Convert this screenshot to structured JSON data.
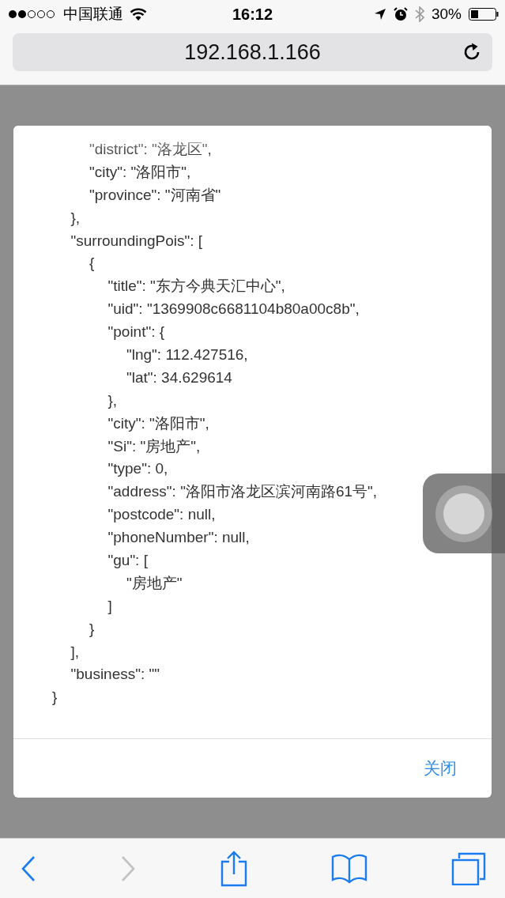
{
  "status_bar": {
    "carrier": "中国联通",
    "time": "16:12",
    "battery": "30%"
  },
  "address_bar": {
    "url": "192.168.1.166"
  },
  "dialog": {
    "lines": [
      {
        "children": [
          {
            "children": [
              {
                "text": "\"district\": \"洛龙区\","
              },
              {
                "text": "\"city\": \"洛阳市\","
              },
              {
                "text": "\"province\": \"河南省\""
              }
            ]
          },
          {
            "text": "},"
          },
          {
            "text": "\"surroundingPois\": [",
            "children": [
              {
                "text": "{",
                "children": [
                  {
                    "text": "\"title\": \"东方今典天汇中心\","
                  },
                  {
                    "text": "\"uid\": \"1369908c6681104b80a00c8b\","
                  },
                  {
                    "text": "\"point\": {",
                    "children": [
                      {
                        "text": "\"lng\": 112.427516,"
                      },
                      {
                        "text": "\"lat\": 34.629614"
                      }
                    ]
                  },
                  {
                    "text": "},"
                  },
                  {
                    "text": "\"city\": \"洛阳市\","
                  },
                  {
                    "text": "\"Si\": \"房地产\","
                  },
                  {
                    "text": "\"type\": 0,"
                  },
                  {
                    "text": "\"address\": \"洛阳市洛龙区滨河南路61号\","
                  },
                  {
                    "text": "\"postcode\": null,"
                  },
                  {
                    "text": "\"phoneNumber\": null,"
                  },
                  {
                    "text": "\"gu\": [",
                    "children": [
                      {
                        "text": "\"房地产\""
                      }
                    ]
                  },
                  {
                    "text": "]"
                  }
                ]
              },
              {
                "text": "}"
              }
            ]
          },
          {
            "text": "],"
          },
          {
            "text": "\"business\": \"\""
          }
        ]
      },
      {
        "text": "}"
      }
    ],
    "close_button": "关闭"
  },
  "toolbar": {
    "back_enabled": true,
    "forward_enabled": false
  }
}
